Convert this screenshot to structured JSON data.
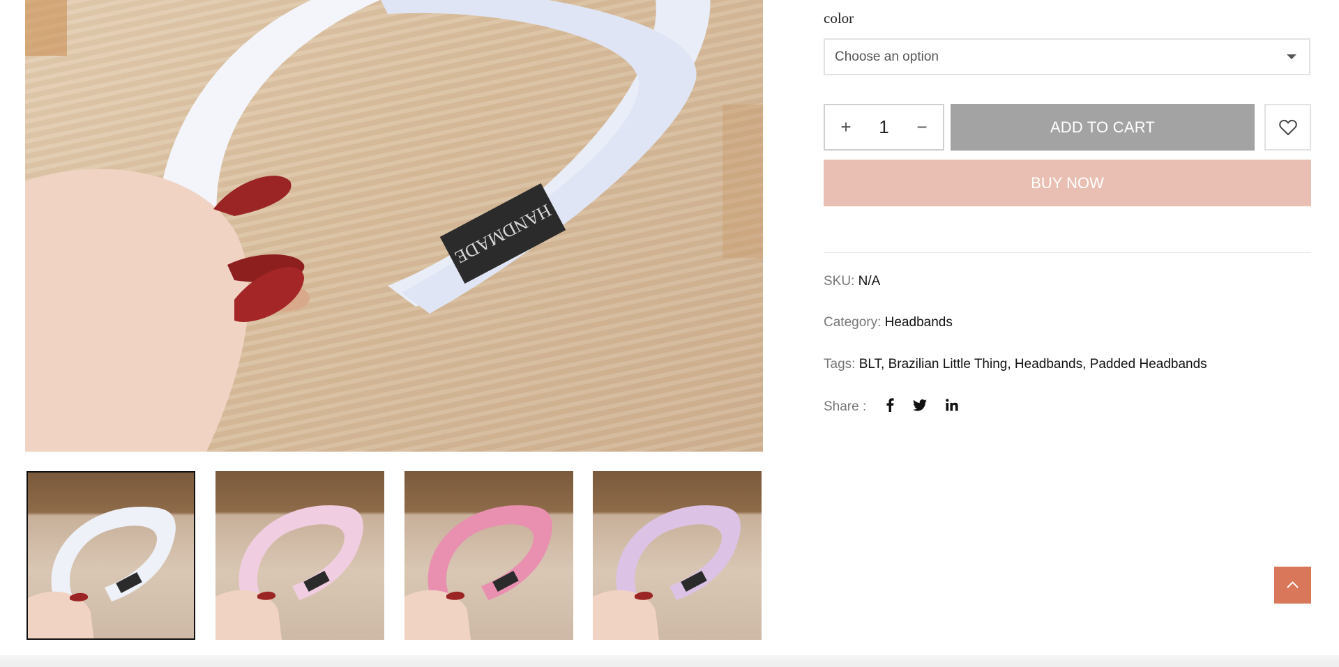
{
  "product": {
    "color_label": "color",
    "color_select": {
      "value": "Choose an option"
    },
    "quantity": "1",
    "add_to_cart_label": "ADD TO CART",
    "buy_now_label": "BUY NOW",
    "main_image_label": "HANDMADE"
  },
  "meta": {
    "sku_label": "SKU:",
    "sku_value": "N/A",
    "category_label": "Category:",
    "category_value": "Headbands",
    "tags_label": "Tags:",
    "tags": [
      "BLT",
      "Brazilian Little Thing",
      "Headbands",
      "Padded Headbands"
    ],
    "share_label": "Share :"
  },
  "gallery": {
    "thumbnails": [
      {
        "color": "#eef1f7",
        "active": true
      },
      {
        "color": "#f0cde0",
        "active": false
      },
      {
        "color": "#e98fb0",
        "active": false
      },
      {
        "color": "#dcc3e6",
        "active": false
      }
    ]
  },
  "colors": {
    "add_to_cart_bg": "#a3a3a3",
    "buy_now_bg": "#e8bfb2",
    "back_to_top_bg": "#d9775a"
  },
  "icons": {
    "wishlist": "heart-icon",
    "share": [
      "facebook-icon",
      "twitter-icon",
      "linkedin-icon"
    ],
    "back_to_top": "chevron-up-icon"
  }
}
